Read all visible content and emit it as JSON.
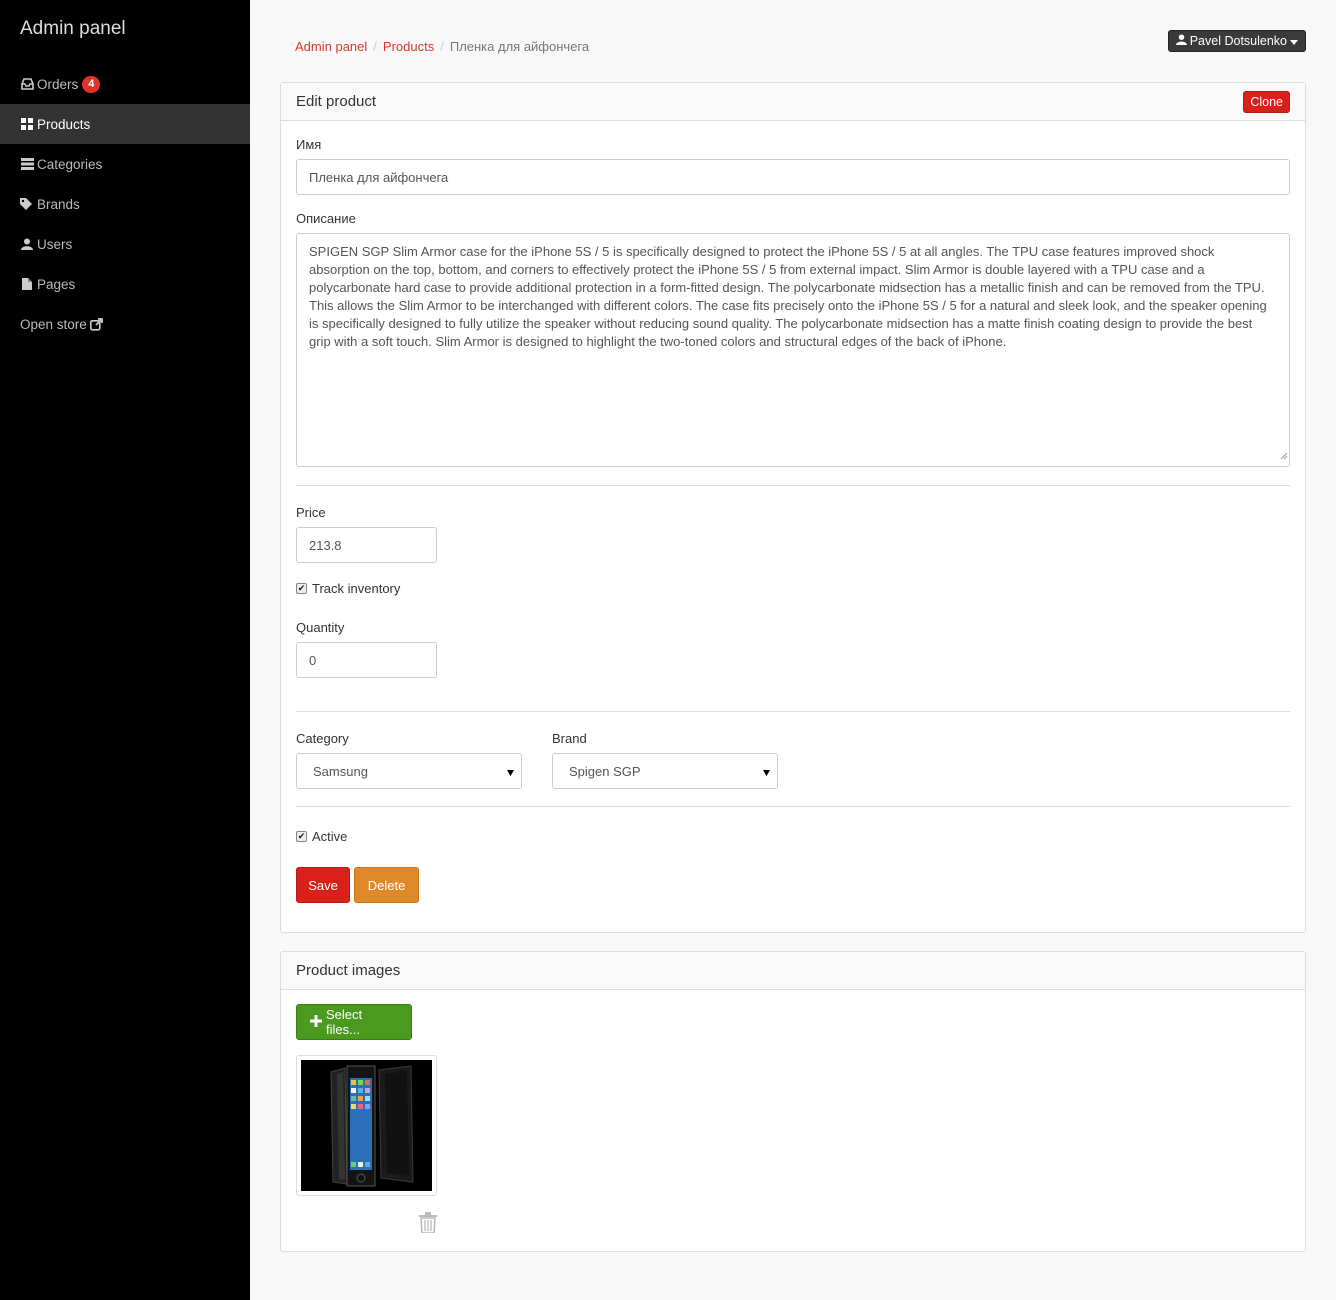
{
  "sidebar": {
    "brand": "Admin panel",
    "items": [
      {
        "label": "Orders",
        "icon": "inbox-icon",
        "badge": "4"
      },
      {
        "label": "Products",
        "icon": "th-large-icon"
      },
      {
        "label": "Categories",
        "icon": "list-icon"
      },
      {
        "label": "Brands",
        "icon": "tags-icon"
      },
      {
        "label": "Users",
        "icon": "user-icon"
      },
      {
        "label": "Pages",
        "icon": "file-icon"
      },
      {
        "label": "Open store",
        "icon": "external-link-icon"
      }
    ],
    "active": "Products"
  },
  "breadcrumb": {
    "home": "Admin panel",
    "section": "Products",
    "current": "Пленка для айфончега"
  },
  "user": {
    "name": "Pavel Dotsulenko"
  },
  "edit_panel": {
    "title": "Edit product",
    "clone_label": "Clone",
    "name_label": "Имя",
    "name_value": "Пленка для айфончега",
    "description_label": "Описание",
    "description_value": "SPIGEN SGP Slim Armor case for the iPhone 5S / 5 is specifically designed to protect the iPhone 5S / 5 at all angles. The TPU case features improved shock absorption on the top, bottom, and corners to effectively protect the iPhone 5S / 5 from external impact. Slim Armor is double layered with a TPU case and a polycarbonate hard case to provide additional protection in a form-fitted design. The polycarbonate midsection has a metallic finish and can be removed from the TPU. This allows the Slim Armor to be interchanged with different colors. The case fits precisely onto the iPhone 5S / 5 for a natural and sleek look, and the speaker opening is specifically designed to fully utilize the speaker without reducing sound quality. The polycarbonate midsection has a matte finish coating design to provide the best grip with a soft touch. Slim Armor is designed to highlight the two-toned colors and structural edges of the back of iPhone.",
    "price_label": "Price",
    "price_value": "213.8",
    "track_inventory_label": "Track inventory",
    "track_inventory_checked": true,
    "quantity_label": "Quantity",
    "quantity_value": "0",
    "category_label": "Category",
    "category_value": "Samsung",
    "brand_label": "Brand",
    "brand_value": "Spigen SGP",
    "active_label": "Active",
    "active_checked": true,
    "save_label": "Save",
    "delete_label": "Delete"
  },
  "images_panel": {
    "title": "Product images",
    "select_files_label": "Select files..."
  },
  "colors": {
    "accent_red": "#d9201a",
    "delete_orange": "#e0892a",
    "success_green": "#4a9a1f",
    "sidebar_bg": "#000000"
  }
}
